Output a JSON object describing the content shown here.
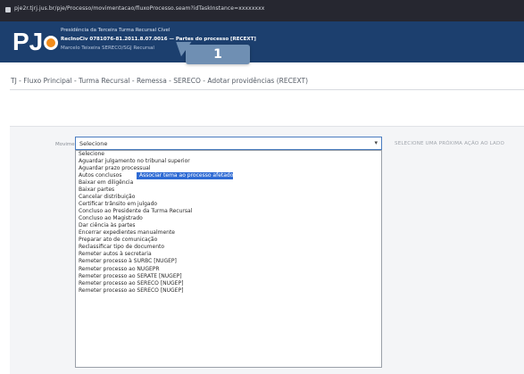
{
  "browser": {
    "url": "pje2r.tjrj.jus.br/pje/Processo/movimentacao/fluxoProcesso.seam?idTaskInstance=xxxxxxxx"
  },
  "header": {
    "logo_text": "PJ",
    "line1": "Presidência da Terceira Turma Recursal Cível",
    "line2": "RecInoCiv 0781076-81.2011.8.07.0016 — Partes do processo [RECEXT]",
    "line3": "Marcelo Teixeira SERECO/SGJ Recursal"
  },
  "callout": {
    "number": "1"
  },
  "breadcrumb": "TJ - Fluxo Principal - Turma Recursal - Remessa - SERECO - Adotar providências (RECEXT)",
  "form": {
    "label": "Movimentação",
    "select_value": "Selecione",
    "hint": "SELECIONE UMA PRÓXIMA AÇÃO AO LADO",
    "options": [
      "Selecione",
      "Aguardar julgamento no tribunal superior",
      "Aguardar prazo processual",
      "Associar tema ao processo afetado",
      "Autos conclusos",
      "Baixar em diligência",
      "Baixar partes",
      "Cancelar distribuição",
      "Certificar trânsito em julgado",
      "Concluso ao Presidente da Turma Recursal",
      "Concluso ao Magistrado",
      "Dar ciência às partes",
      "Encerrar expedientes manualmente",
      "Preparar ato de comunicação",
      "Reclassificar tipo de documento",
      "Remeter autos à secretaria",
      "Remeter processo à SURBC [NUGEP]",
      "Remeter processo ao NUGEPR",
      "Remeter processo ao SERATE [NUGEP]",
      "Remeter processo ao SERECO [NUGEP]",
      "Remeter processo ao SERECO [NUGEP]"
    ],
    "highlighted_index": 3
  },
  "colors": {
    "header_bg": "#1c3f6e",
    "logo_accent": "#f28c1a",
    "highlight": "#2f6bd4",
    "callout": "#6f8fb3"
  },
  "icons": {
    "lock": "lock-icon",
    "chevron": "chevron-down-icon",
    "arrow": "arrow-callout-icon"
  }
}
